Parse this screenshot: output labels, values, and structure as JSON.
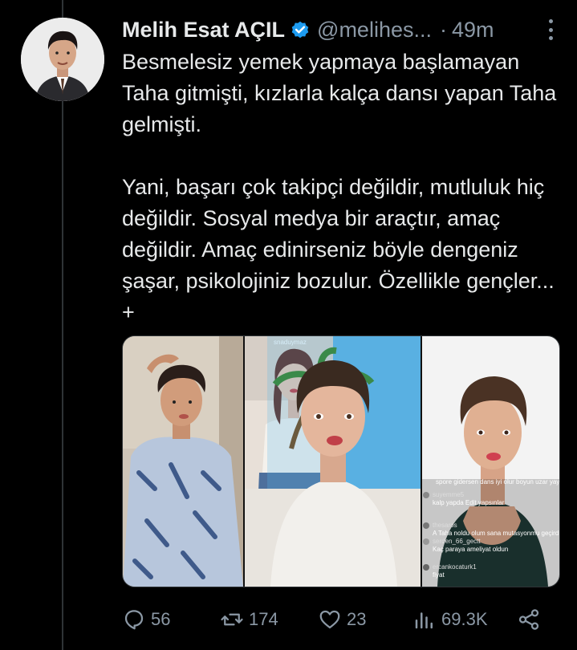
{
  "tweet": {
    "author_name": "Melih Esat AÇIL",
    "handle": "@melihes...",
    "separator": "·",
    "time": "49m",
    "paragraphs": [
      "Besmelesiz yemek yapmaya başlamayan Taha gitmişti, kızlarla kalça dansı yapan Taha gelmişti.",
      "Yani, başarı çok takipçi değildir, mutluluk hiç değildir. Sosyal medya bir araçtır, amaç değildir. Amaç edinirseniz böyle dengeniz şaşar, psikolojiniz bozulur. Özellikle gençler... +"
    ]
  },
  "media": {
    "panel2_watermark": "snaduymaz",
    "comments": [
      "spore gidersen dans iyi olur boyun uzar yay",
      "suyemme5",
      "kalp yapda Edit yapsınlar",
      "thesaros",
      "A Taha noldu olum sana mutasyonmu geçird",
      "serden_66_gectt",
      "Kaç paraya ameliyat oldun",
      "ercankocaturk1",
      "fiyat"
    ]
  },
  "actions": {
    "replies": "56",
    "retweets": "174",
    "likes": "23",
    "views": "69.3K"
  },
  "colors": {
    "background": "#000000",
    "text": "#e7e9ea",
    "secondary": "#8b98a5",
    "verified": "#1d9bf0"
  },
  "icons": [
    "verified-badge-icon",
    "more-icon",
    "reply-icon",
    "retweet-icon",
    "like-icon",
    "views-icon",
    "share-icon"
  ]
}
